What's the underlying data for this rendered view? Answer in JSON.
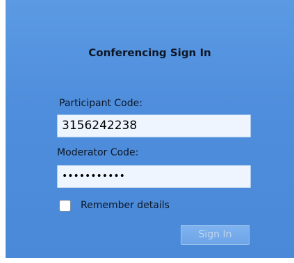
{
  "signin": {
    "title": "Conferencing Sign In",
    "participant_label": "Participant Code:",
    "participant_value": "3156242238",
    "moderator_label": "Moderator Code:",
    "moderator_value": "•••••••••••",
    "remember_label": "Remember details",
    "remember_checked": false,
    "signin_label": "Sign In"
  },
  "colors": {
    "panel_background": "#4f8edc",
    "field_background": "#eef5ff",
    "disabled_button": "#6ea5e8"
  }
}
